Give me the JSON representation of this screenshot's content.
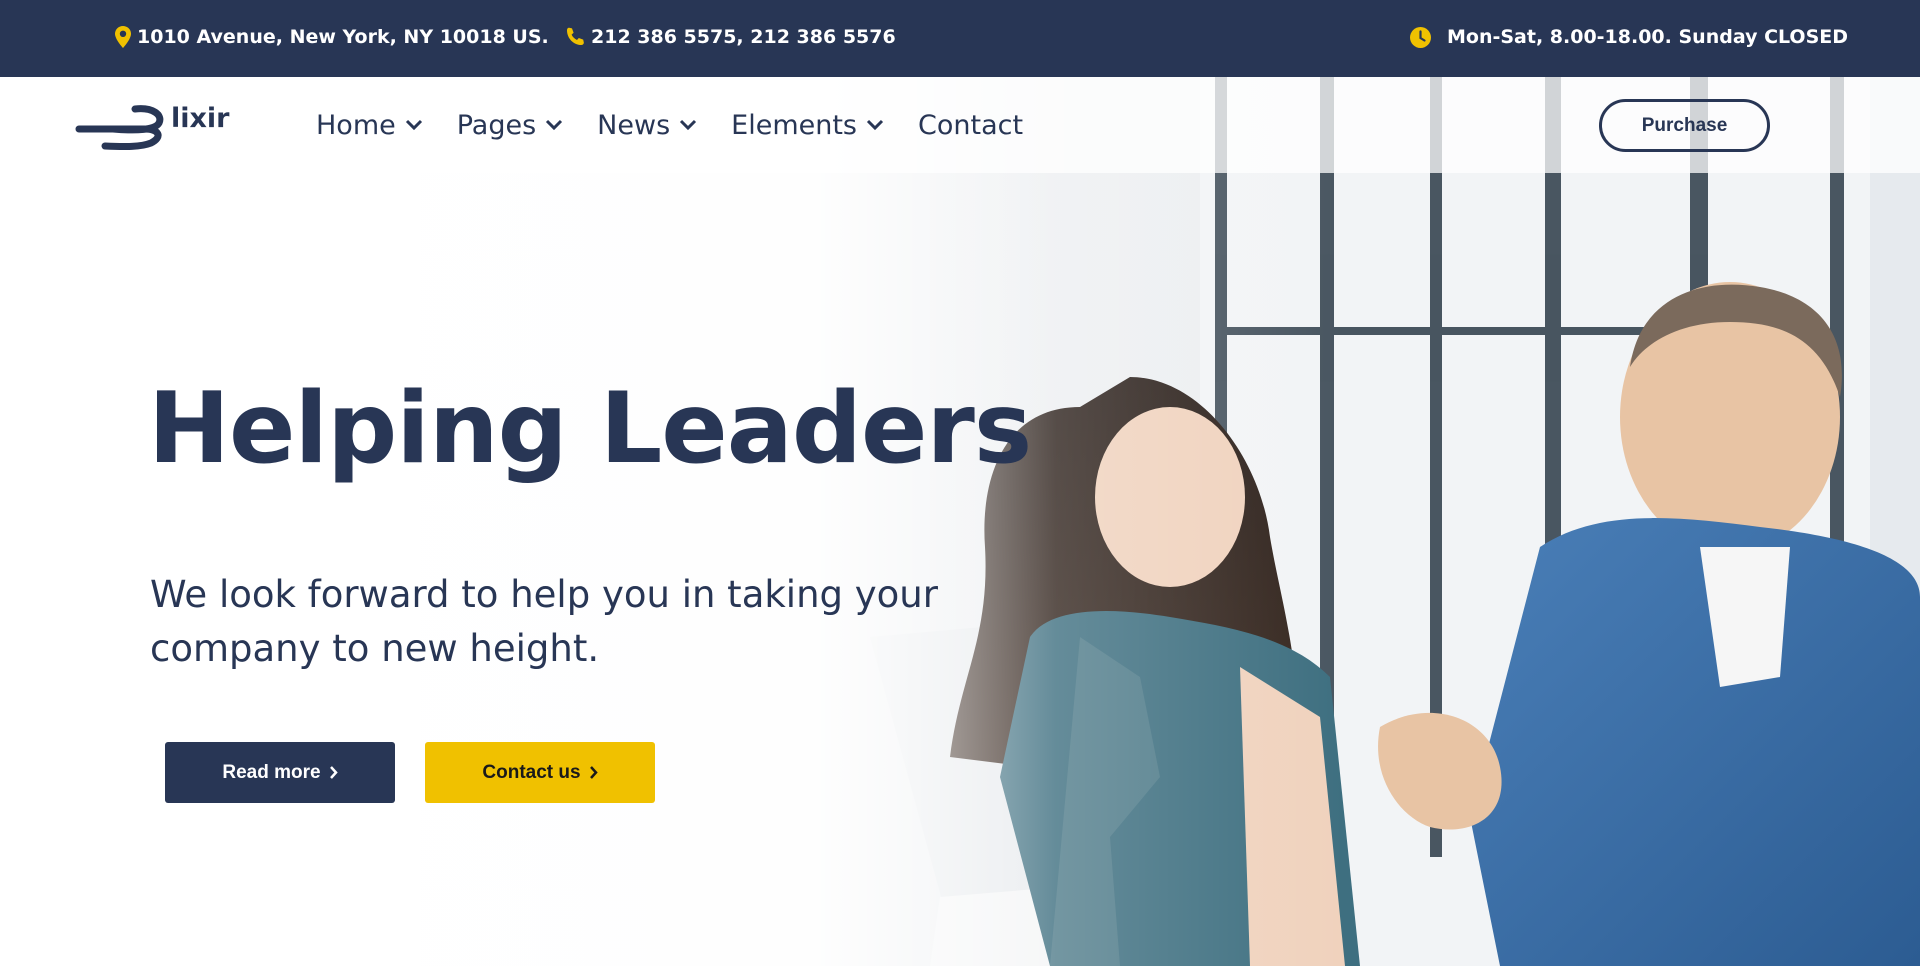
{
  "colors": {
    "navy": "#283655",
    "accent_yellow": "#f0c100",
    "white": "#ffffff"
  },
  "topbar": {
    "address": "1010 Avenue, New York, NY 10018 US.",
    "address_icon": "map-pin-icon",
    "phone": "212 386 5575, 212 386 5576",
    "phone_icon": "phone-icon",
    "hours": "Mon-Sat, 8.00-18.00. Sunday CLOSED",
    "hours_icon": "clock-icon"
  },
  "header": {
    "logo_text": "lixir",
    "nav": [
      {
        "label": "Home",
        "has_dropdown": true
      },
      {
        "label": "Pages",
        "has_dropdown": true
      },
      {
        "label": "News",
        "has_dropdown": true
      },
      {
        "label": "Elements",
        "has_dropdown": true
      },
      {
        "label": "Contact",
        "has_dropdown": false
      }
    ],
    "purchase_label": "Purchase"
  },
  "hero": {
    "title": "Helping Leaders",
    "subtitle": "We look forward to help you in taking your company to new height.",
    "read_more_label": "Read more",
    "contact_label": "Contact us"
  }
}
